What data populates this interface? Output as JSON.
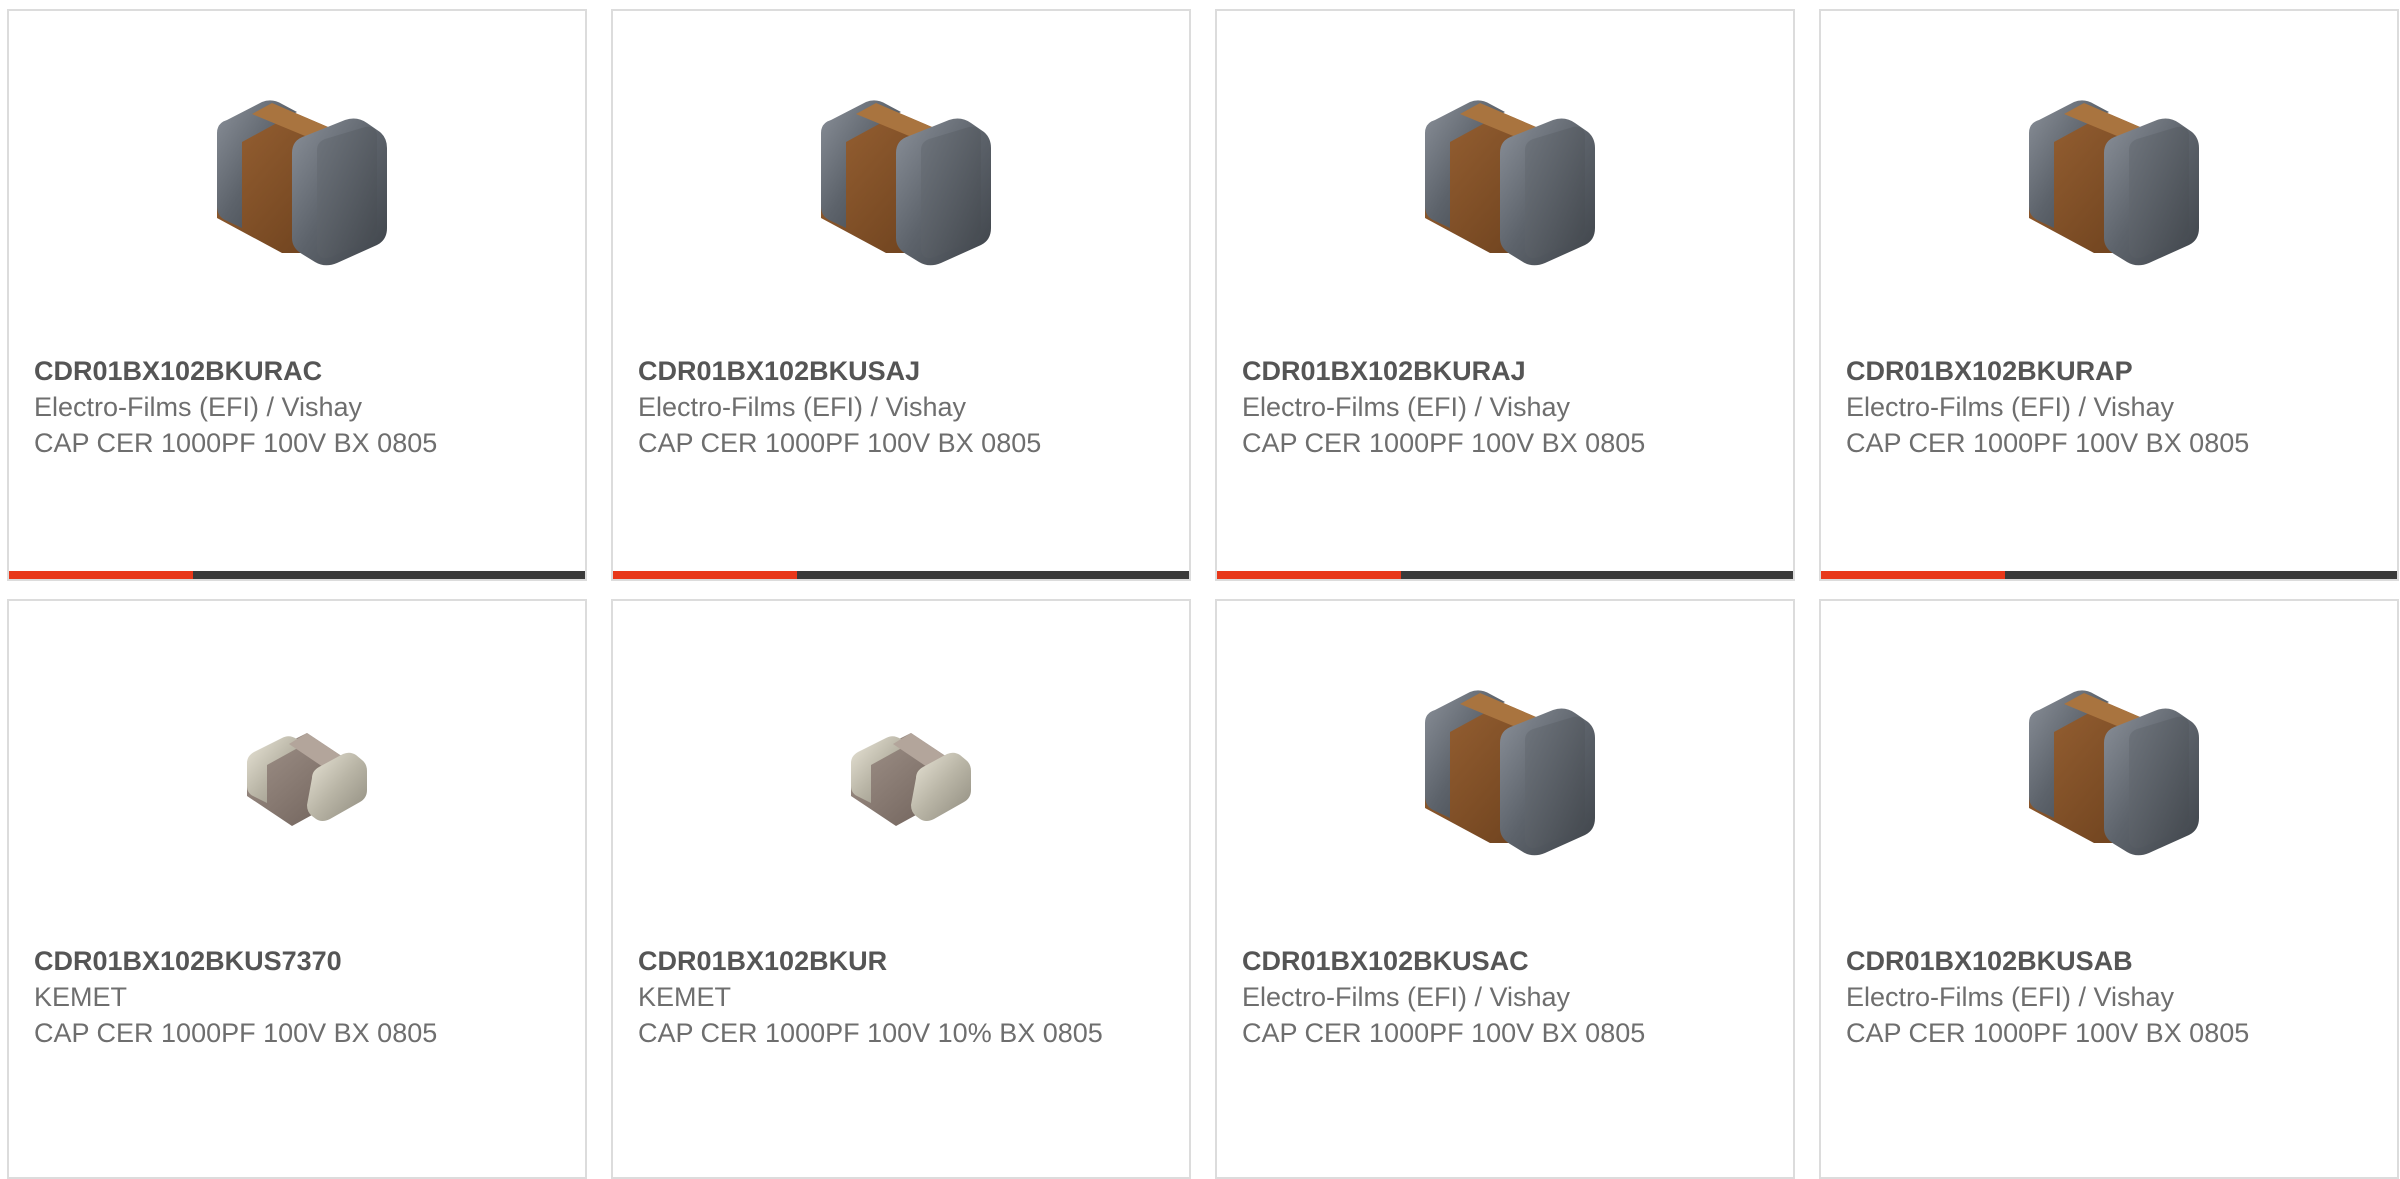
{
  "colors": {
    "accent": "#e8381a",
    "bar_track": "#3a3a3a",
    "border": "#dcdcdc",
    "part_text": "#555555",
    "body_text": "#6e6e6e"
  },
  "products": [
    {
      "part_number": "CDR01BX102BKURAC",
      "manufacturer": "Electro-Films (EFI) / Vishay",
      "description": "CAP CER 1000PF 100V BX 0805",
      "image_icon": "capacitor-large-icon",
      "progress": 0.32
    },
    {
      "part_number": "CDR01BX102BKUSAJ",
      "manufacturer": "Electro-Films (EFI) / Vishay",
      "description": "CAP CER 1000PF 100V BX 0805",
      "image_icon": "capacitor-large-icon",
      "progress": 0.32
    },
    {
      "part_number": "CDR01BX102BKURAJ",
      "manufacturer": "Electro-Films (EFI) / Vishay",
      "description": "CAP CER 1000PF 100V BX 0805",
      "image_icon": "capacitor-large-icon",
      "progress": 0.32
    },
    {
      "part_number": "CDR01BX102BKURAP",
      "manufacturer": "Electro-Films (EFI) / Vishay",
      "description": "CAP CER 1000PF 100V BX 0805",
      "image_icon": "capacitor-large-icon",
      "progress": 0.32
    },
    {
      "part_number": "CDR01BX102BKUS7370",
      "manufacturer": "KEMET",
      "description": "CAP CER 1000PF 100V BX 0805",
      "image_icon": "capacitor-small-icon"
    },
    {
      "part_number": "CDR01BX102BKUR",
      "manufacturer": "KEMET",
      "description": "CAP CER 1000PF 100V 10% BX 0805",
      "image_icon": "capacitor-small-icon"
    },
    {
      "part_number": "CDR01BX102BKUSAC",
      "manufacturer": "Electro-Films (EFI) / Vishay",
      "description": "CAP CER 1000PF 100V BX 0805",
      "image_icon": "capacitor-large-icon"
    },
    {
      "part_number": "CDR01BX102BKUSAB",
      "manufacturer": "Electro-Films (EFI) / Vishay",
      "description": "CAP CER 1000PF 100V BX 0805",
      "image_icon": "capacitor-large-icon"
    }
  ]
}
